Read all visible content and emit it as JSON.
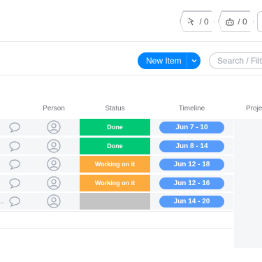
{
  "toolbar": {
    "automations_count": "/ 0",
    "integrations_count": "/ 0",
    "new_item_label": "New Item",
    "search_placeholder": "Search / Filter"
  },
  "columns": {
    "person": "Person",
    "status": "Status",
    "timeline": "Timeline",
    "project": "Proje"
  },
  "rows": [
    {
      "status": "Done",
      "status_color": "#00c875",
      "timeline": "Jun 7 - 10"
    },
    {
      "status": "Done",
      "status_color": "#00c875",
      "timeline": "Jun 8 - 14"
    },
    {
      "status": "Working on it",
      "status_color": "#fdab3d",
      "timeline": "Jun 12 - 18"
    },
    {
      "status": "Working on it",
      "status_color": "#fdab3d",
      "timeline": "Jun 12 - 16"
    },
    {
      "status": "",
      "status_color": "#c4c4c4",
      "timeline": "Jun 14 - 20"
    }
  ],
  "row_truncation": "..",
  "colors": {
    "accent": "#0085ff",
    "done": "#00c875",
    "working": "#fdab3d",
    "empty": "#c4c4c4",
    "timeline": "#579bfc"
  },
  "icons": {
    "automations": "automation-icon",
    "integrations": "integration-icon",
    "updates": "chat-bubble-icon",
    "person": "person-avatar-icon"
  }
}
